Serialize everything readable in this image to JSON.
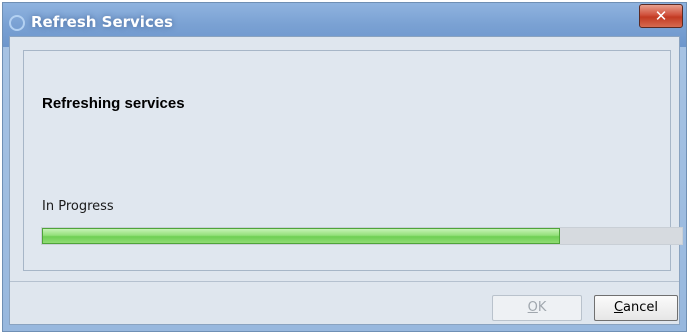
{
  "window": {
    "title": "Refresh Services",
    "close_label": "✕"
  },
  "dialog": {
    "heading": "Refreshing services",
    "status": "In Progress",
    "progress": 0.81
  },
  "buttons": {
    "ok_mnemonic": "O",
    "ok_rest": "K",
    "ok_enabled": false,
    "cancel_mnemonic": "C",
    "cancel_rest": "ancel"
  },
  "colors": {
    "progress_fill": "#7ad65f",
    "titlebar": "#7aa1d3",
    "close_button": "#c94a33"
  },
  "icons": {
    "app": "app-icon",
    "close": "close-icon"
  }
}
